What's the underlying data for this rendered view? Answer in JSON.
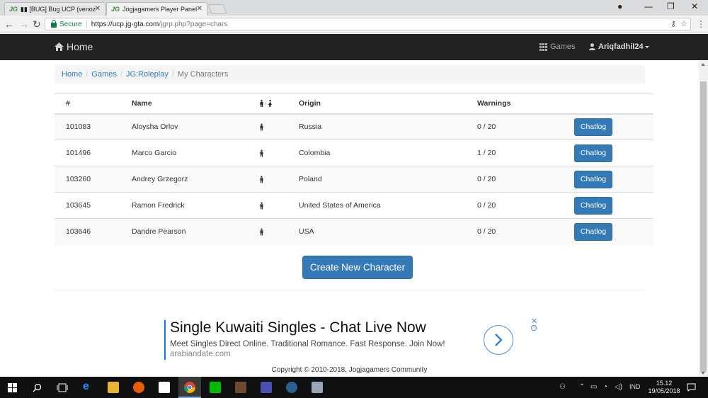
{
  "browser": {
    "tabs": [
      {
        "label": "▮▮ [BUG] Bug UCP (venoz",
        "favicon": "JG"
      },
      {
        "label": "Jogjagamers Player Panel",
        "favicon": "JG"
      }
    ],
    "secure_label": "Secure",
    "url_host": "https://ucp.jg-gta.com",
    "url_path": "/jgrp.php?page=chars"
  },
  "navbar": {
    "brand": "Home",
    "games": "Games",
    "user": "Ariqfadhil24"
  },
  "breadcrumb": {
    "items": [
      "Home",
      "Games",
      "JG:Roleplay"
    ],
    "current": "My Characters"
  },
  "table": {
    "headers": [
      "#",
      "Name",
      "",
      "Origin",
      "Warnings",
      ""
    ],
    "rows": [
      {
        "id": "101083",
        "name": "Aloysha Orlov",
        "origin": "Russia",
        "warnings": "0 / 20",
        "action": "Chatlog"
      },
      {
        "id": "101496",
        "name": "Marco Garcio",
        "origin": "Colombia",
        "warnings": "1 / 20",
        "action": "Chatlog"
      },
      {
        "id": "103260",
        "name": "Andrey Grzegorz",
        "origin": "Poland",
        "warnings": "0 / 20",
        "action": "Chatlog"
      },
      {
        "id": "103645",
        "name": "Ramon Fredrick",
        "origin": "United States of America",
        "warnings": "0 / 20",
        "action": "Chatlog"
      },
      {
        "id": "103646",
        "name": "Dandre Pearson",
        "origin": "USA",
        "warnings": "0 / 20",
        "action": "Chatlog"
      }
    ]
  },
  "create_button": "Create New Character",
  "ad": {
    "title": "Single Kuwaiti Singles - Chat Live Now",
    "description": "Meet Singles Direct Online. Traditional Romance. Fast Response. Join Now!",
    "url": "arabiandate.com"
  },
  "footer": "Copyright © 2010-2018, Jogjagamers Community",
  "taskbar": {
    "language": "IND",
    "time": "15.12",
    "date": "19/05/2018"
  },
  "colors": {
    "primary": "#337ab7",
    "navbar": "#222222",
    "secure": "#0b8043"
  }
}
